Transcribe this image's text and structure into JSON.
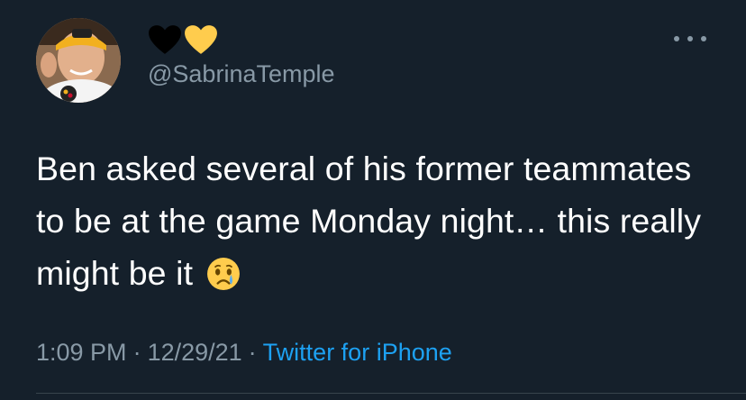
{
  "tweet": {
    "display_name_icons": [
      "black-heart-icon",
      "yellow-heart-icon"
    ],
    "handle": "@SabrinaTemple",
    "body_text": "Ben asked several of his former teammates to be at the game Monday night… this really might be it",
    "emoji": "crying-face-icon",
    "time": "1:09 PM",
    "date": "12/29/21",
    "separator": "·",
    "source": "Twitter for iPhone"
  },
  "colors": {
    "background": "#15202b",
    "text": "#ffffff",
    "secondary": "#8899a6",
    "link": "#1da1f2",
    "heart_black": "#000000",
    "heart_yellow": "#ffcc4d"
  }
}
